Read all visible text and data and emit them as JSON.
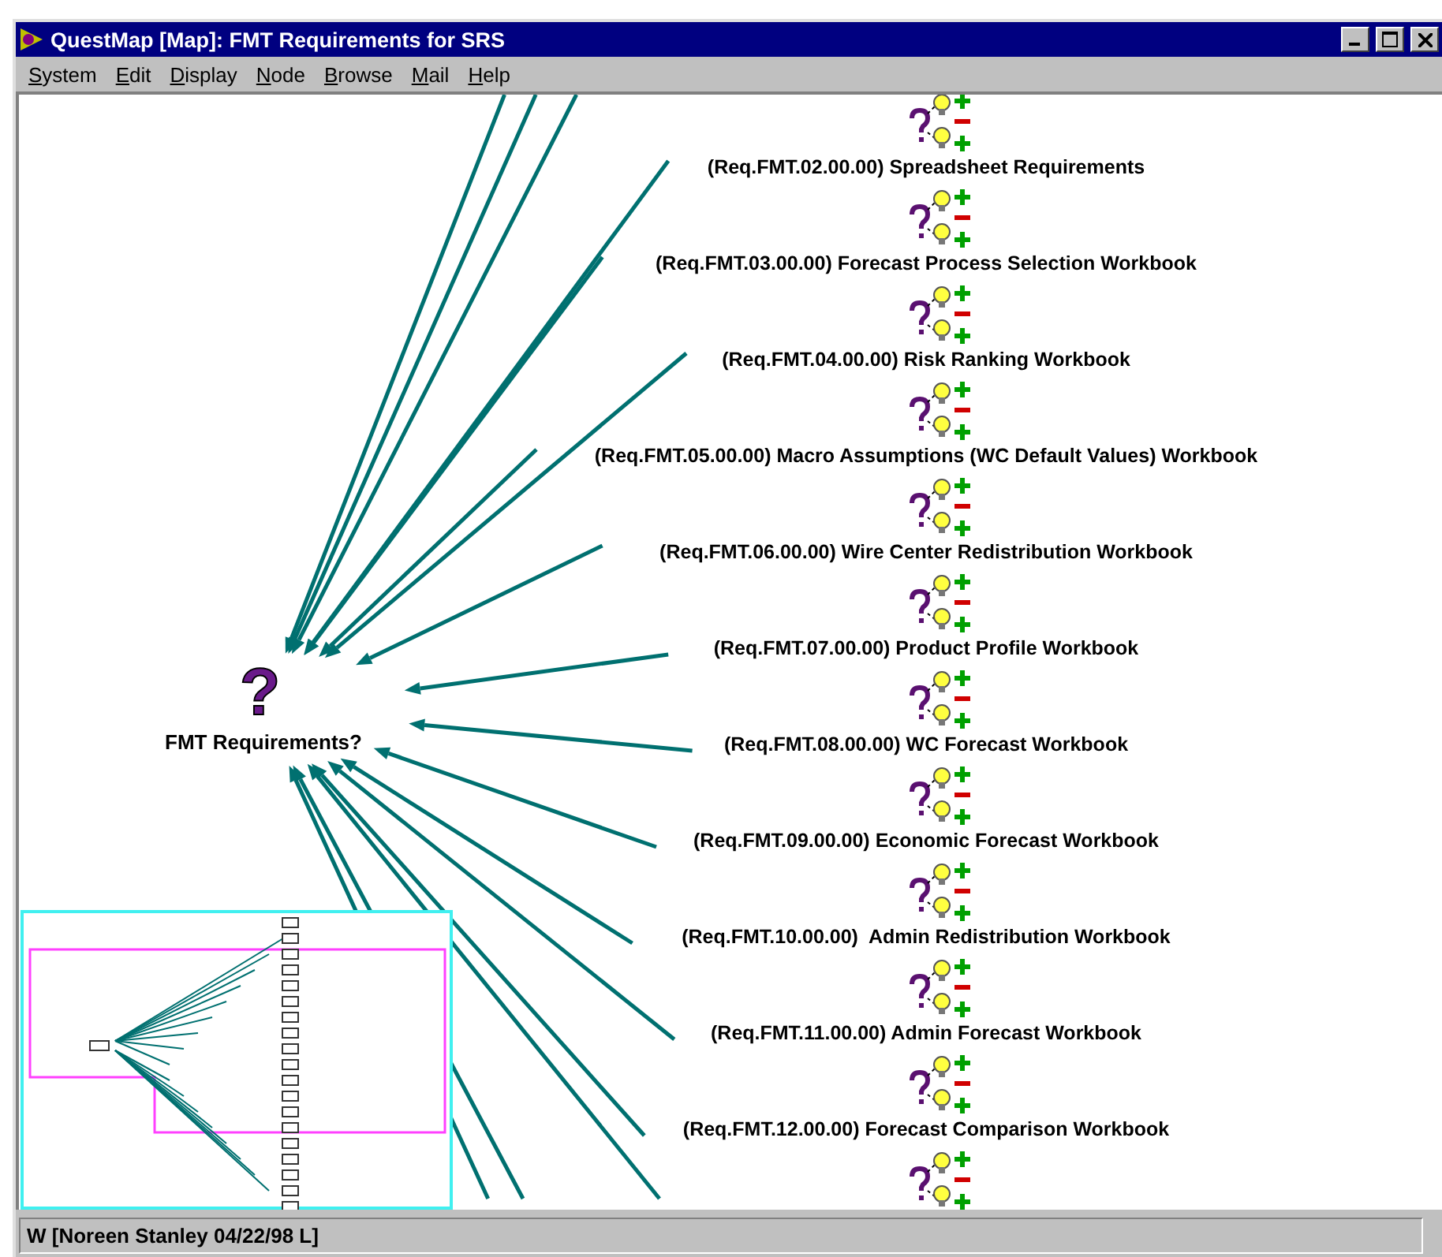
{
  "window": {
    "title": "QuestMap [Map]: FMT Requirements for SRS"
  },
  "menu": [
    "System",
    "Edit",
    "Display",
    "Node",
    "Browse",
    "Mail",
    "Help"
  ],
  "central_node": {
    "icon": "?",
    "label": "FMT Requirements?"
  },
  "nodes": [
    {
      "kind": "labeled",
      "label": "(Req.FMT.02.00.00) Spreadsheet Requirements"
    },
    {
      "kind": "labeled",
      "label": "(Req.FMT.03.00.00) Forecast Process Selection Workbook"
    },
    {
      "kind": "labeled",
      "label": "(Req.FMT.04.00.00) Risk Ranking Workbook"
    },
    {
      "kind": "labeled",
      "label": "(Req.FMT.05.00.00) Macro Assumptions (WC Default Values) Workbook"
    },
    {
      "kind": "labeled",
      "label": "(Req.FMT.06.00.00) Wire Center Redistribution Workbook"
    },
    {
      "kind": "labeled",
      "label": "(Req.FMT.07.00.00) Product Profile Workbook"
    },
    {
      "kind": "labeled",
      "label": "(Req.FMT.08.00.00) WC Forecast Workbook"
    },
    {
      "kind": "labeled",
      "label": "(Req.FMT.09.00.00) Economic Forecast Workbook"
    },
    {
      "kind": "labeled",
      "label": "(Req.FMT.10.00.00)  Admin Redistribution Workbook"
    },
    {
      "kind": "labeled",
      "label": "(Req.FMT.11.00.00) Admin Forecast Workbook"
    },
    {
      "kind": "labeled",
      "label": "(Req.FMT.12.00.00) Forecast Comparison Workbook"
    },
    {
      "kind": "cut-off"
    }
  ],
  "status_bar": {
    "text": "W [Noreen Stanley 04/22/98 L]"
  }
}
